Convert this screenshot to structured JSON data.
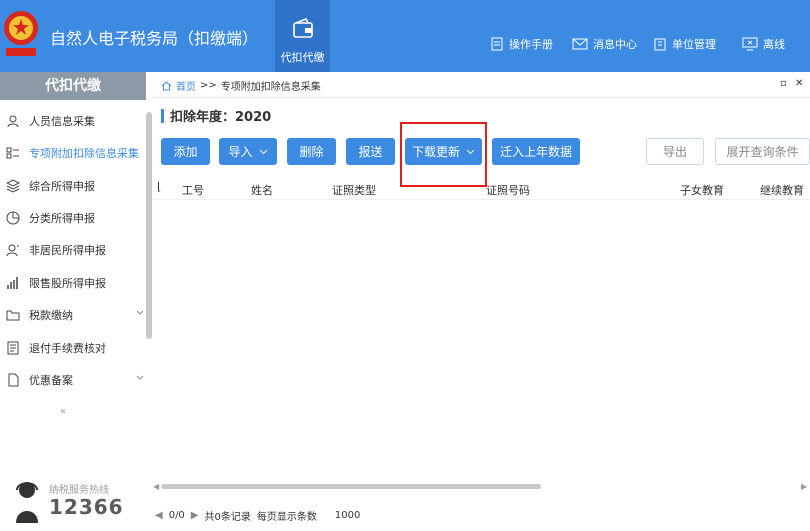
{
  "header": {
    "app_title": "自然人电子税务局（扣缴端）",
    "module_label": "代扣代缴",
    "links": [
      "操作手册",
      "消息中心",
      "单位管理",
      "离线"
    ]
  },
  "sidebar": {
    "title": "代扣代缴",
    "items": [
      {
        "label": "人员信息采集",
        "icon": "person-icon"
      },
      {
        "label": "专项附加扣除信息采集",
        "icon": "list-icon",
        "active": true
      },
      {
        "label": "综合所得申报",
        "icon": "layers-icon"
      },
      {
        "label": "分类所得申报",
        "icon": "pie-icon"
      },
      {
        "label": "非居民所得申报",
        "icon": "person-outline-icon"
      },
      {
        "label": "限售股所得申报",
        "icon": "bar-chart-icon"
      },
      {
        "label": "税款缴纳",
        "icon": "folder-icon",
        "expandable": true
      },
      {
        "label": "退付手续费核对",
        "icon": "document-check-icon"
      },
      {
        "label": "优惠备案",
        "icon": "file-icon",
        "expandable": true
      }
    ],
    "collapse_glyph": "«",
    "hotline": {
      "label": "纳税服务热线",
      "number": "12366"
    }
  },
  "breadcrumb": {
    "home": "首页",
    "separator": ">>",
    "current": "专项附加扣除信息采集"
  },
  "year": {
    "label": "扣除年度：2020"
  },
  "toolbar": {
    "add": "添加",
    "import": "导入",
    "delete": "删除",
    "submit": "报送",
    "download_update": "下载更新",
    "migrate": "迁入上年数据",
    "export": "导出",
    "expand_query": "展开查询条件"
  },
  "table": {
    "columns": [
      "工号",
      "姓名",
      "证照类型",
      "证照号码",
      "子女教育",
      "继续教育"
    ]
  },
  "pager": {
    "page": "0/0",
    "total": "共0条记录",
    "per_page_label": "每页显示条数",
    "per_page": "1000"
  },
  "colors": {
    "primary": "#3d8ae3",
    "highlight": "#e02020",
    "sidebar_title": "#8c99a6"
  }
}
